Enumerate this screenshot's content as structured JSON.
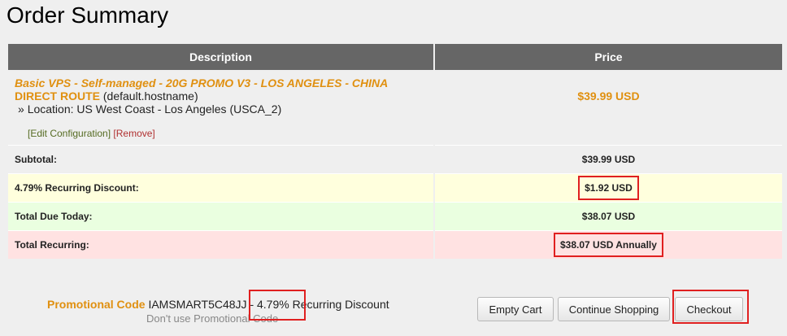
{
  "page": {
    "title": "Order Summary"
  },
  "table": {
    "headers": {
      "description": "Description",
      "price": "Price"
    },
    "item": {
      "product": "Basic VPS - Self-managed - 20G PROMO V3 - LOS ANGELES - CHINA",
      "product_line2": "DIRECT ROUTE",
      "hostname": "(default.hostname)",
      "location_prefix": "»",
      "location": "Location: US West Coast - Los Angeles (USCA_2)",
      "edit_label": "[Edit Configuration]",
      "remove_label": "[Remove]",
      "price": "$39.99 USD"
    },
    "rows": {
      "subtotal": {
        "label": "Subtotal:",
        "value": "$39.99 USD"
      },
      "discount": {
        "label": "4.79% Recurring Discount:",
        "value": "$1.92 USD"
      },
      "due_today": {
        "label": "Total Due Today:",
        "value": "$38.07 USD"
      },
      "recurring": {
        "label": "Total Recurring:",
        "value": "$38.07 USD Annually"
      }
    }
  },
  "promo": {
    "label": "Promotional Code",
    "code_text": "IAMSMART5C48JJ - 4.79% Recurring Discount",
    "remove_link": "Don't use Promotional Code"
  },
  "buttons": {
    "empty_cart": "Empty Cart",
    "continue_shopping": "Continue Shopping",
    "checkout": "Checkout"
  },
  "colors": {
    "accent": "#e09010",
    "header_bg": "#666666",
    "highlight": "#e02020"
  }
}
